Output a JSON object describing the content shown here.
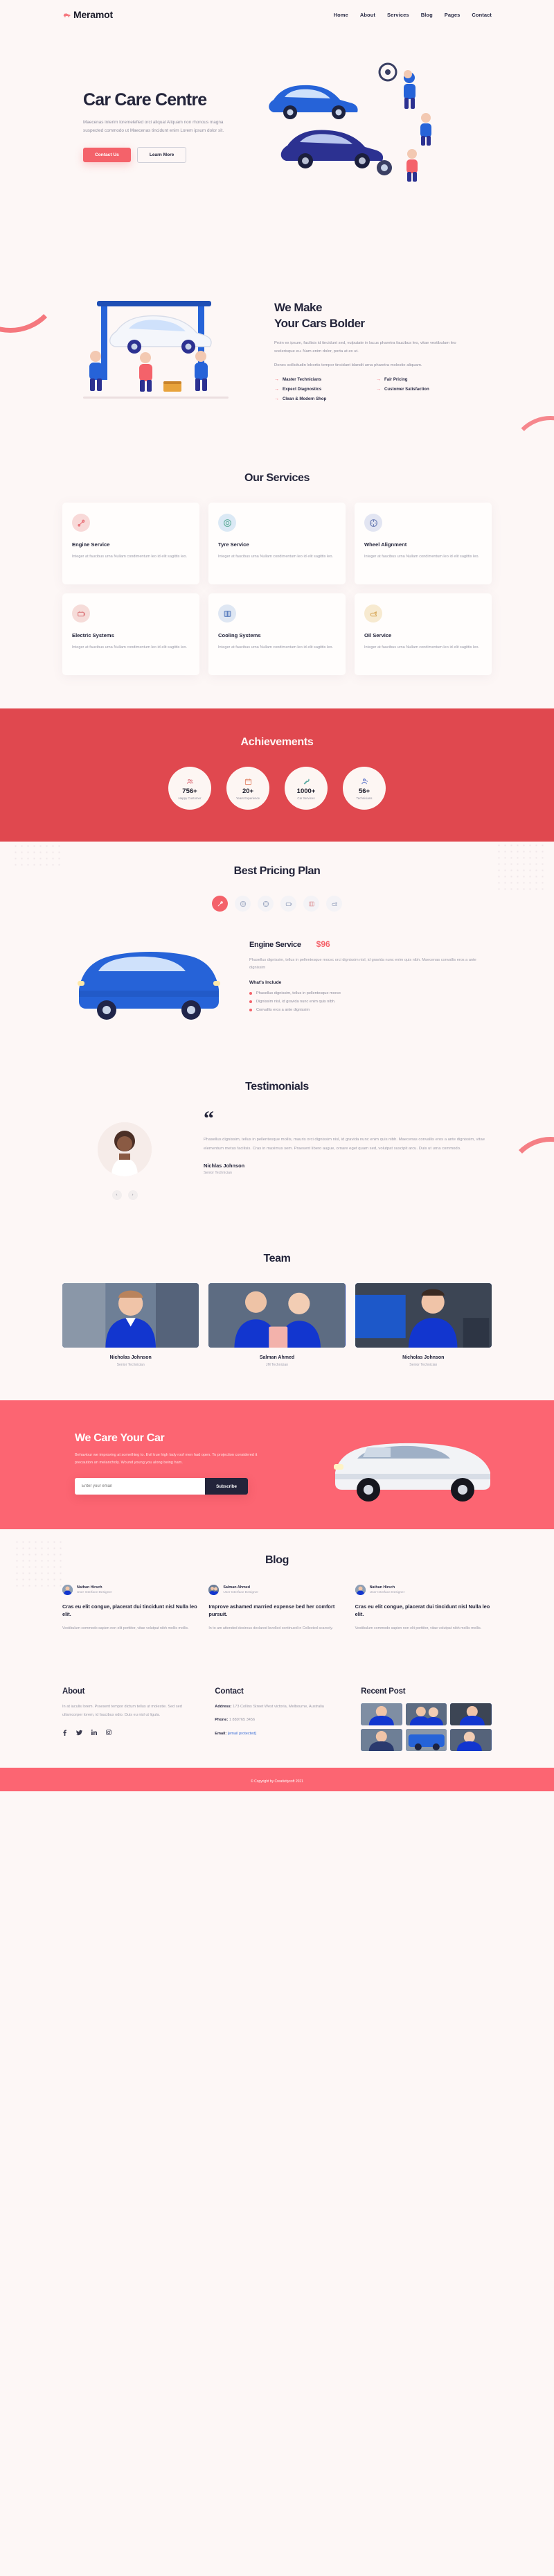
{
  "brand": {
    "name": "Meramot",
    "dot_color": "#f4626a",
    "logo_icon": "car-logo-icon"
  },
  "nav": {
    "items": [
      {
        "label": "Home"
      },
      {
        "label": "About"
      },
      {
        "label": "Services"
      },
      {
        "label": "Blog"
      },
      {
        "label": "Pages"
      },
      {
        "label": "Contact"
      }
    ]
  },
  "hero": {
    "title": "Car Care Centre",
    "paragraph": "Maecenas interim loremelefied orci aliqual Aliquam non rhonous magna suspected commodo ut Maecenas tincidunt enim Lorem ipsum dolor sit.",
    "primary_button": "Contact Us",
    "secondary_button": "Learn More",
    "illustration": "mechanics-repairing-cars-illustration"
  },
  "about": {
    "title_line1": "We Make",
    "title_line2": "Your Cars Bolder",
    "paragraph1": "Proin ex ipsum, facilisis id tincidunt sed, vulputate in lacus pharetra faucibus leo, vitae vestibulum leo scelerisque eu. Nam enim dolor, porta at ex ut.",
    "paragraph2": "Donec sollicitudin lobortis tempor tincidunt blandit urna pharetra molestie aliquam.",
    "features": [
      {
        "label": "Master Technicians"
      },
      {
        "label": "Fair Pricing"
      },
      {
        "label": "Expect Diagnostics"
      },
      {
        "label": "Customer Satisfaction"
      },
      {
        "label": "Clean & Modern Shop"
      }
    ],
    "illustration": "car-on-lift-illustration"
  },
  "services": {
    "title": "Our Services",
    "body": "Integer at faucibus urna Nullam condimentum leo id elit sagittis leo.",
    "cards": [
      {
        "title": "Engine Service",
        "icon": "wrench-screwdriver-icon",
        "icon_bg": "#f8d9d8",
        "icon_color": "#e8737a"
      },
      {
        "title": "Tyre Service",
        "icon": "tyre-icon",
        "icon_bg": "#dbe9f5",
        "icon_color": "#5fae9a"
      },
      {
        "title": "Wheel Alignment",
        "icon": "wheel-icon",
        "icon_bg": "#e2e5f2",
        "icon_color": "#6d7fb5"
      },
      {
        "title": "Electric Systems",
        "icon": "battery-icon",
        "icon_bg": "#f6dcd9",
        "icon_color": "#dd7f82"
      },
      {
        "title": "Cooling Systems",
        "icon": "radiator-icon",
        "icon_bg": "#dfe7f3",
        "icon_color": "#5d80c0"
      },
      {
        "title": "Oil Service",
        "icon": "oil-can-icon",
        "icon_bg": "#f7ead0",
        "icon_color": "#d7a85a"
      }
    ]
  },
  "achievements": {
    "title": "Achievements",
    "bg_color": "#e0484f",
    "items": [
      {
        "number": "756+",
        "label": "Happy Customer",
        "icon": "customers-icon",
        "icon_color": "#e07d86"
      },
      {
        "number": "20+",
        "label": "Years Experience",
        "icon": "calendar-icon",
        "icon_color": "#e2886b"
      },
      {
        "number": "1000+",
        "label": "Car Services",
        "icon": "wrench-icon",
        "icon_color": "#56a79f"
      },
      {
        "number": "56+",
        "label": "Technicians",
        "icon": "technician-icon",
        "icon_color": "#4a66c4"
      }
    ]
  },
  "pricing": {
    "title": "Best Pricing Plan",
    "tabs": [
      {
        "icon": "wrench-screwdriver-icon",
        "active": true
      },
      {
        "icon": "tyre-icon",
        "active": false
      },
      {
        "icon": "wheel-icon",
        "active": false
      },
      {
        "icon": "battery-icon",
        "active": false
      },
      {
        "icon": "radiator-icon",
        "active": false
      },
      {
        "icon": "oil-can-icon",
        "active": false
      }
    ],
    "plan_name": "Engine Service",
    "amount": "$96",
    "description": "Phasellus dignissim, tellus in pellentesque mocvc orci dignissim nisl, id gravida nunc enim quis nibh. Maecenas convallis eros a ante dignissim",
    "include_title": "What's Include",
    "includes": [
      {
        "text": "Phasellus dignissim, tellus in pellentesque mocvc"
      },
      {
        "text": "Dignissim nisl, id gravida nunc enim quis nibh."
      },
      {
        "text": "Convallis eros a ante dignissim"
      }
    ],
    "illustration": "blue-car-illustration"
  },
  "testimonials": {
    "title": "Testimonials",
    "quote_glyph": "“",
    "quote": "Phasellus dignissim, tellus in pellentesque mollis, mauris orci dignissim nisl, id gravida nunc enim quis nibh. Maecenas convallis eros a ante dignissim, vitae elementum metus facilisis. Cras in maximus sem. Praesent libero augue, ornare eget quam sed, volutpat suscipit arcu. Duis ut urna commodo.",
    "name": "Nichlas Johnson",
    "role": "Senior Technician",
    "avatar": "smiling-woman-photo",
    "prev_label": "‹",
    "next_label": "›"
  },
  "team": {
    "title": "Team",
    "members": [
      {
        "name": "Nicholas Johnson",
        "role": "Senior Technician",
        "photo": "mechanic-portrait-1"
      },
      {
        "name": "Salman Ahmed",
        "role": "JM Technician",
        "photo": "mechanic-portrait-2"
      },
      {
        "name": "Nicholas Johnson",
        "role": "Senior Technician",
        "photo": "mechanic-portrait-3"
      }
    ]
  },
  "newsletter": {
    "title": "We Care Your Car",
    "paragraph": "Behaviour we improving at something to. Evil true high lady roof men had open. To projection considered it precaution an melancholy. Wound young you along being ham.",
    "input_placeholder": "Enter your email",
    "input_value": "",
    "button": "Subscribe",
    "bg_color": "#fc6572",
    "illustration": "white-suv-photo"
  },
  "blog": {
    "title": "Blog",
    "posts": [
      {
        "author": "Nathan Hirsch",
        "role": "User Interface Designer",
        "avatar": "author-avatar-1",
        "title": "Cras eu elit congue, placerat dui tincidunt nisl Nulla leo elit.",
        "excerpt": "Vestibulum commodo sapien non elit porttitor, vitae volutpat nibh mollis mollis."
      },
      {
        "author": "Salman Ahmed",
        "role": "User Interface Designer",
        "avatar": "author-avatar-2",
        "title": "Improve ashamed married expense bed her comfort pursuit.",
        "excerpt": "In to am attended desirous declared levelled continued in Collected scarcely."
      },
      {
        "author": "Nathan Hirsch",
        "role": "User Interface Designer",
        "avatar": "author-avatar-3",
        "title": "Cras eu elit congue, placerat dui tincidunt nisl Nulla leo elit.",
        "excerpt": "Vestibulum commodo sapien non elit porttitor, vitae volutpat nibh mollis mollis."
      }
    ]
  },
  "footer": {
    "about_title": "About",
    "about_text": "In at iaculis lorem. Praesent tempor dictum tellus ut molestie. Sed sed ullamcorper lorem, id faucibus odio. Duis eu nisl ut ligula.",
    "socials": [
      {
        "icon": "facebook-icon",
        "glyph": "f"
      },
      {
        "icon": "twitter-icon",
        "glyph": "t"
      },
      {
        "icon": "linkedin-icon",
        "glyph": "in"
      },
      {
        "icon": "instagram-icon",
        "glyph": "▢"
      }
    ],
    "contact_title": "Contact",
    "address_label": "Address:",
    "address_value": "173 Collins Street West victoria, Melbourne, Australia",
    "phone_label": "Phone:",
    "phone_value": "1 889765 3456",
    "email_label": "Email:",
    "email_value": "[email protected]",
    "recent_title": "Recent Post",
    "recent_posts": [
      {
        "photo": "recent-post-1"
      },
      {
        "photo": "recent-post-2"
      },
      {
        "photo": "recent-post-3"
      },
      {
        "photo": "recent-post-4"
      },
      {
        "photo": "recent-post-5"
      },
      {
        "photo": "recent-post-6"
      }
    ],
    "copyright": "© Copyright by Creativitysoft 2021",
    "bar_color": "#fc6572"
  }
}
